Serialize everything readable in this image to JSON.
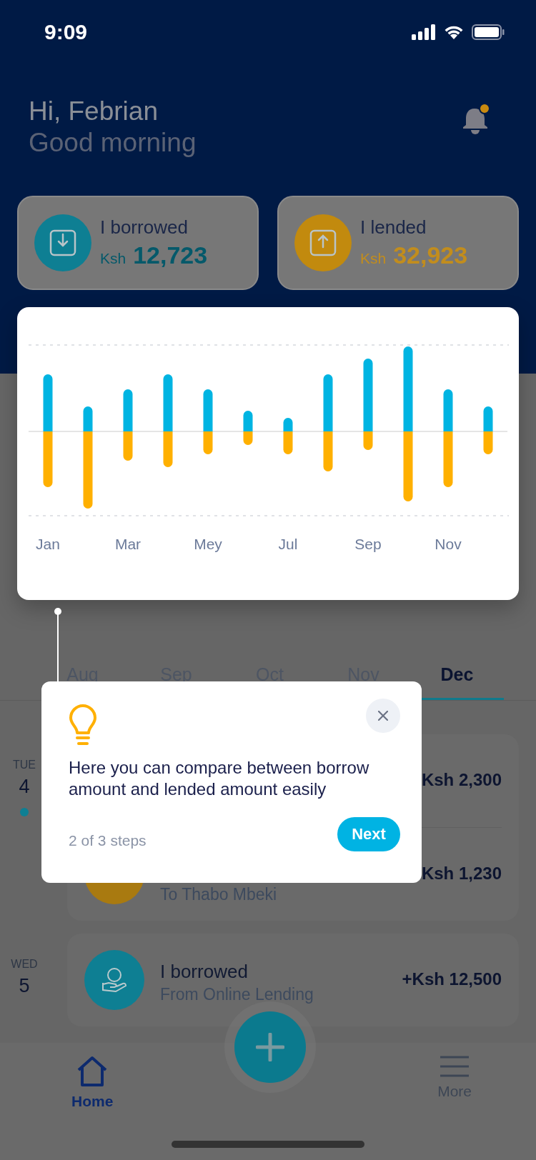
{
  "status_bar": {
    "time": "9:09"
  },
  "greeting": {
    "title": "Hi, Febrian",
    "subtitle": "Good morning"
  },
  "notifications": {
    "unread": true
  },
  "summary_cards": [
    {
      "kind": "borrowed",
      "label": "I borrowed",
      "currency": "Ksh",
      "amount": "12,723"
    },
    {
      "kind": "lended",
      "label": "I lended",
      "currency": "Ksh",
      "amount": "32,923"
    }
  ],
  "chart": {
    "month_labels": [
      "Jan",
      "Mar",
      "Mey",
      "Jul",
      "Sep",
      "Nov"
    ]
  },
  "month_tabs": [
    {
      "label": "Aug",
      "selected": false
    },
    {
      "label": "Sep",
      "selected": false
    },
    {
      "label": "Oct",
      "selected": false
    },
    {
      "label": "Nov",
      "selected": false
    },
    {
      "label": "Dec",
      "selected": true
    }
  ],
  "transactions": [
    {
      "day": "TUE",
      "date": "4",
      "items": [
        {
          "amount": "Ksh 2,300"
        },
        {
          "kind": "lended",
          "subtitle": "To Thabo Mbeki",
          "amount": "Ksh 1,230"
        }
      ]
    },
    {
      "day": "WED",
      "date": "5",
      "items": [
        {
          "kind": "borrowed",
          "title": "I borrowed",
          "subtitle": "From Online Lending",
          "amount": "+Ksh 12,500"
        }
      ]
    }
  ],
  "tooltip": {
    "text": "Here you can compare between borrow amount and lended amount easily",
    "steps": "2 of 3 steps",
    "next": "Next"
  },
  "nav": [
    {
      "kind": "home",
      "label": "Home",
      "selected": true
    },
    {
      "kind": "more",
      "label": "More",
      "selected": false
    }
  ]
}
